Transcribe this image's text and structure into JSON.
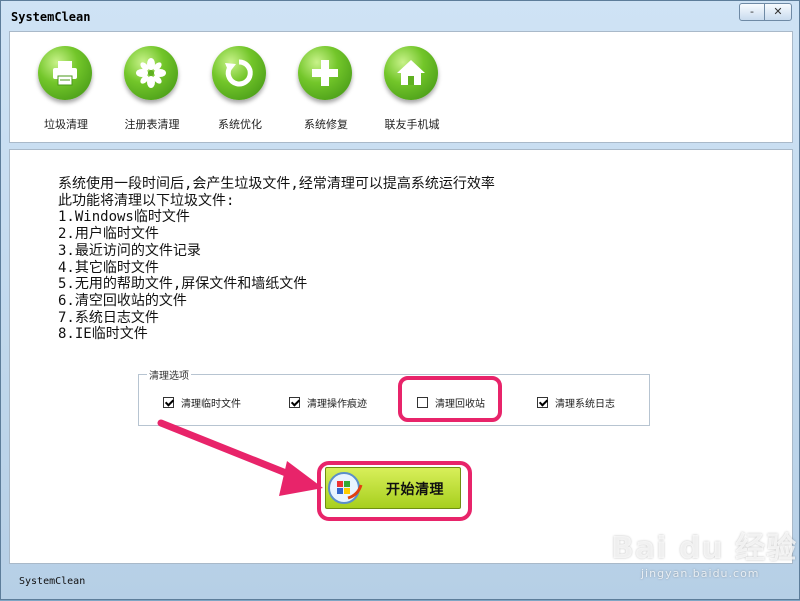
{
  "window": {
    "title": "SystemClean",
    "minimize_label": "-",
    "close_label": "✕"
  },
  "toolbar": {
    "items": [
      {
        "label": "垃圾清理",
        "icon": "printer-icon"
      },
      {
        "label": "注册表清理",
        "icon": "flower-icon"
      },
      {
        "label": "系统优化",
        "icon": "refresh-icon"
      },
      {
        "label": "系统修复",
        "icon": "plus-icon"
      },
      {
        "label": "联友手机城",
        "icon": "home-icon"
      }
    ]
  },
  "description": {
    "lines": [
      "系统使用一段时间后,会产生垃圾文件,经常清理可以提高系统运行效率",
      "此功能将清理以下垃圾文件:",
      "1.Windows临时文件",
      "2.用户临时文件",
      "3.最近访问的文件记录",
      "4.其它临时文件",
      "5.无用的帮助文件,屏保文件和墙纸文件",
      "6.清空回收站的文件",
      "7.系统日志文件",
      "8.IE临时文件"
    ]
  },
  "options": {
    "title": "清理选项",
    "items": [
      {
        "label": "清理临时文件",
        "checked": true
      },
      {
        "label": "清理操作痕迹",
        "checked": true
      },
      {
        "label": "清理回收站",
        "checked": false
      },
      {
        "label": "清理系统日志",
        "checked": true
      }
    ]
  },
  "start_button": {
    "label": "开始清理"
  },
  "status": {
    "text": "SystemClean"
  },
  "watermark": {
    "main": "Bai du 经验",
    "sub": "jingyan.baidu.com"
  },
  "colors": {
    "accent_green": "#73c62a",
    "highlight": "#e8246a",
    "button_green": "#a7cf1e"
  }
}
